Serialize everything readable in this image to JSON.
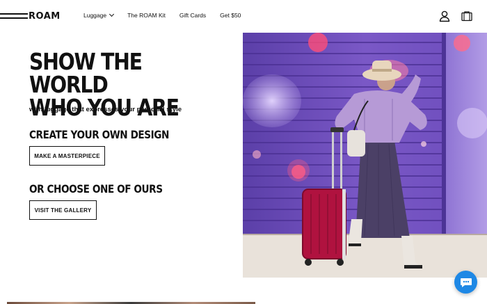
{
  "brand": {
    "logo_text": "ROAM"
  },
  "nav": {
    "items": [
      {
        "label": "Luggage",
        "has_dropdown": true
      },
      {
        "label": "The ROAM Kit"
      },
      {
        "label": "Gift Cards"
      },
      {
        "label": "Get $50"
      }
    ]
  },
  "header_icons": {
    "account": "user-icon",
    "cart": "bag-icon"
  },
  "hero": {
    "title_line1": "SHOW THE WORLD",
    "title_line2": "WHO YOU ARE",
    "subtitle": "with luggage that expresses your personal style"
  },
  "create": {
    "heading": "CREATE YOUR OWN DESIGN",
    "button": "MAKE A MASTERPIECE"
  },
  "choose": {
    "heading": "OR CHOOSE ONE OF OURS",
    "button": "VISIT THE GALLERY"
  },
  "colors": {
    "accent": "#111111",
    "chat": "#1e88e5",
    "wall": "#6a4fb8",
    "suitcase": "#b0123f"
  },
  "chat": {
    "icon": "chat-bubble-icon"
  }
}
